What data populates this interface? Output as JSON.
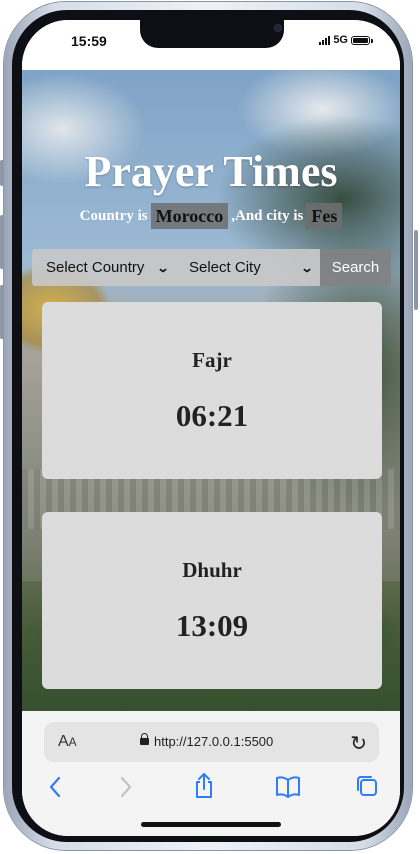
{
  "status": {
    "time": "15:59",
    "network": "5G"
  },
  "page": {
    "title": "Prayer Times",
    "subtitle": {
      "prefix": "Country is",
      "country": "Morocco",
      "middle": ",And city is",
      "city": "Fes"
    },
    "country_select": {
      "value": "Select Country"
    },
    "city_select": {
      "value": "Select City"
    },
    "search_label": "Search",
    "prayers": [
      {
        "name": "Fajr",
        "time": "06:21"
      },
      {
        "name": "Dhuhr",
        "time": "13:09"
      }
    ]
  },
  "browser": {
    "text_size_label": {
      "big": "A",
      "small": "A"
    },
    "url": "http://127.0.0.1:5500"
  },
  "icons": {
    "back": "chevron-left-icon",
    "forward": "chevron-right-icon",
    "share": "share-icon",
    "bookmarks": "book-icon",
    "tabs": "tabs-icon",
    "reload": "reload-icon",
    "lock": "lock-icon"
  }
}
